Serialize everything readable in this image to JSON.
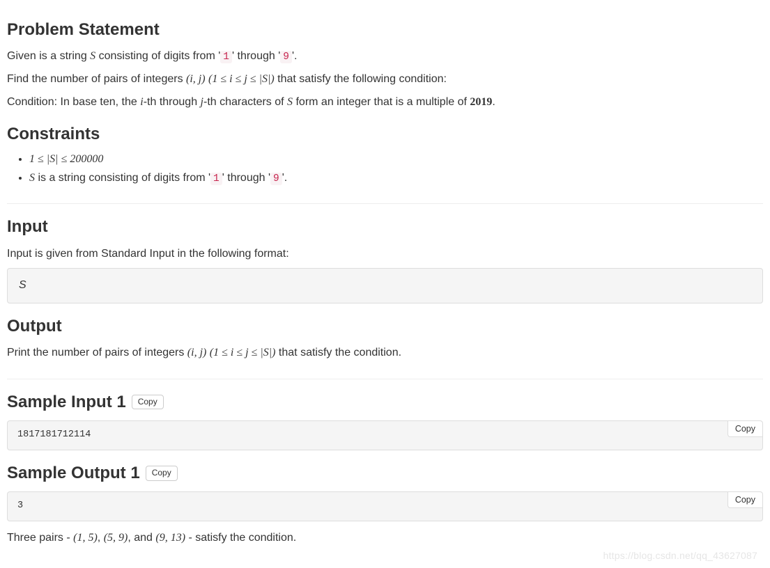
{
  "sections": {
    "problem": {
      "heading": "Problem Statement",
      "p1_a": "Given is a string ",
      "p1_Svar": "S",
      "p1_b": " consisting of digits from ",
      "p1_d1": "1",
      "p1_c": " through ",
      "p1_d9": "9",
      "p1_d": ".",
      "p2_a": "Find the number of pairs of integers ",
      "p2_ij": "(i, j)",
      "p2_space": " ",
      "p2_cond": "(1 ≤ i ≤ j ≤ |S|)",
      "p2_b": " that satisfy the following condition:",
      "p3_a": "Condition: In base ten, the ",
      "p3_i": "i",
      "p3_b": "-th through ",
      "p3_j": "j",
      "p3_c": "-th characters of ",
      "p3_S": "S",
      "p3_d": " form an integer that is a multiple of ",
      "p3_2019": "2019",
      "p3_e": "."
    },
    "constraints": {
      "heading": "Constraints",
      "li1": "1 ≤ |S| ≤ 200000",
      "li2_S": "S",
      "li2_a": " is a string consisting of digits from ",
      "li2_d1": "1",
      "li2_b": " through ",
      "li2_d9": "9",
      "li2_c": "."
    },
    "input": {
      "heading": "Input",
      "desc": "Input is given from Standard Input in the following format:",
      "block": "S"
    },
    "output": {
      "heading": "Output",
      "p_a": "Print the number of pairs of integers ",
      "p_ij": "(i, j)",
      "p_space": " ",
      "p_cond": "(1 ≤ i ≤ j ≤ |S|)",
      "p_b": " that satisfy the condition."
    },
    "sample_in": {
      "heading": "Sample Input 1",
      "copy_btn": "Copy",
      "block_copy_btn": "Copy",
      "value": "1817181712114"
    },
    "sample_out": {
      "heading": "Sample Output 1",
      "copy_btn": "Copy",
      "block_copy_btn": "Copy",
      "value": "3",
      "exp_a": "Three pairs - ",
      "exp_p1": "(1, 5)",
      "exp_s1": ", ",
      "exp_p2": "(5, 9)",
      "exp_s2": ", and ",
      "exp_p3": "(9, 13)",
      "exp_b": " - satisfy the condition."
    }
  },
  "watermark": "https://blog.csdn.net/qq_43627087"
}
